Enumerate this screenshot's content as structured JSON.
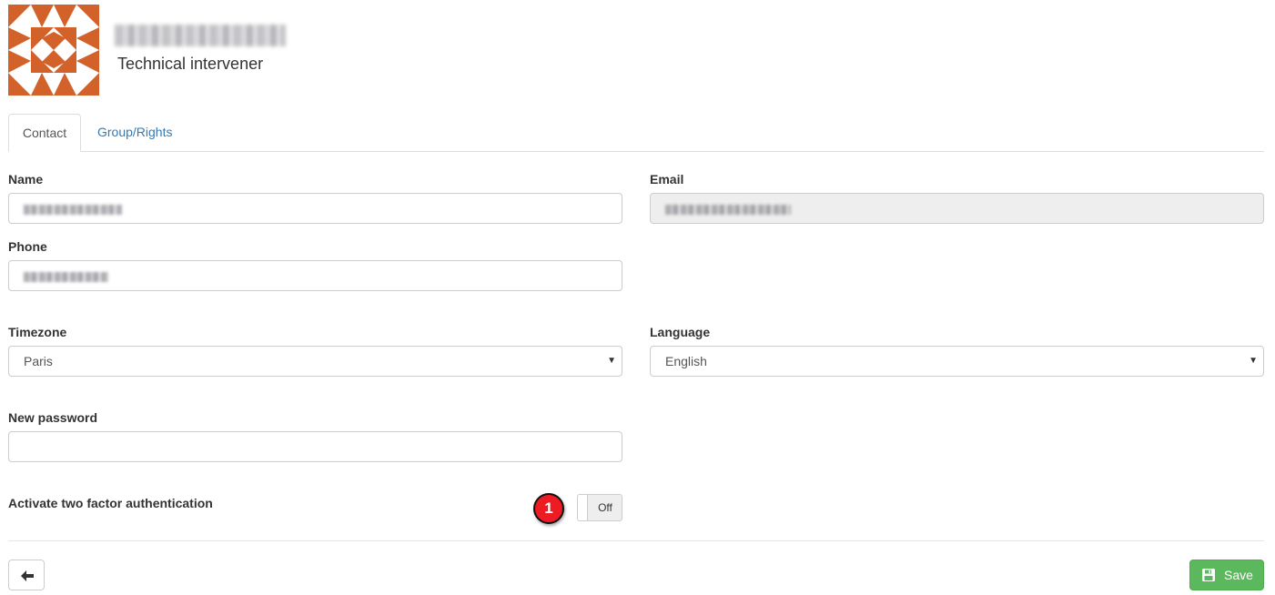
{
  "profile": {
    "name_redacted": "(name redacted)",
    "role": "Technical intervener"
  },
  "tabs": [
    {
      "label": "Contact",
      "active": true
    },
    {
      "label": "Group/Rights",
      "active": false
    }
  ],
  "form": {
    "name": {
      "label": "Name",
      "value_redacted": true
    },
    "email": {
      "label": "Email",
      "value_redacted": true,
      "disabled": true
    },
    "phone": {
      "label": "Phone",
      "value_redacted": true
    },
    "timezone": {
      "label": "Timezone",
      "value": "Paris"
    },
    "language": {
      "label": "Language",
      "value": "English"
    },
    "new_password": {
      "label": "New password",
      "value": ""
    },
    "two_factor": {
      "label": "Activate two factor authentication",
      "state": "Off"
    }
  },
  "annotation": {
    "marker": "1"
  },
  "actions": {
    "back_icon": "arrow-left-icon",
    "save_icon": "floppy-disk-icon",
    "save_label": "Save"
  },
  "colors": {
    "avatar": "#d2622a",
    "link": "#337ab7",
    "save": "#5cb85c",
    "marker": "#ed1c24"
  }
}
